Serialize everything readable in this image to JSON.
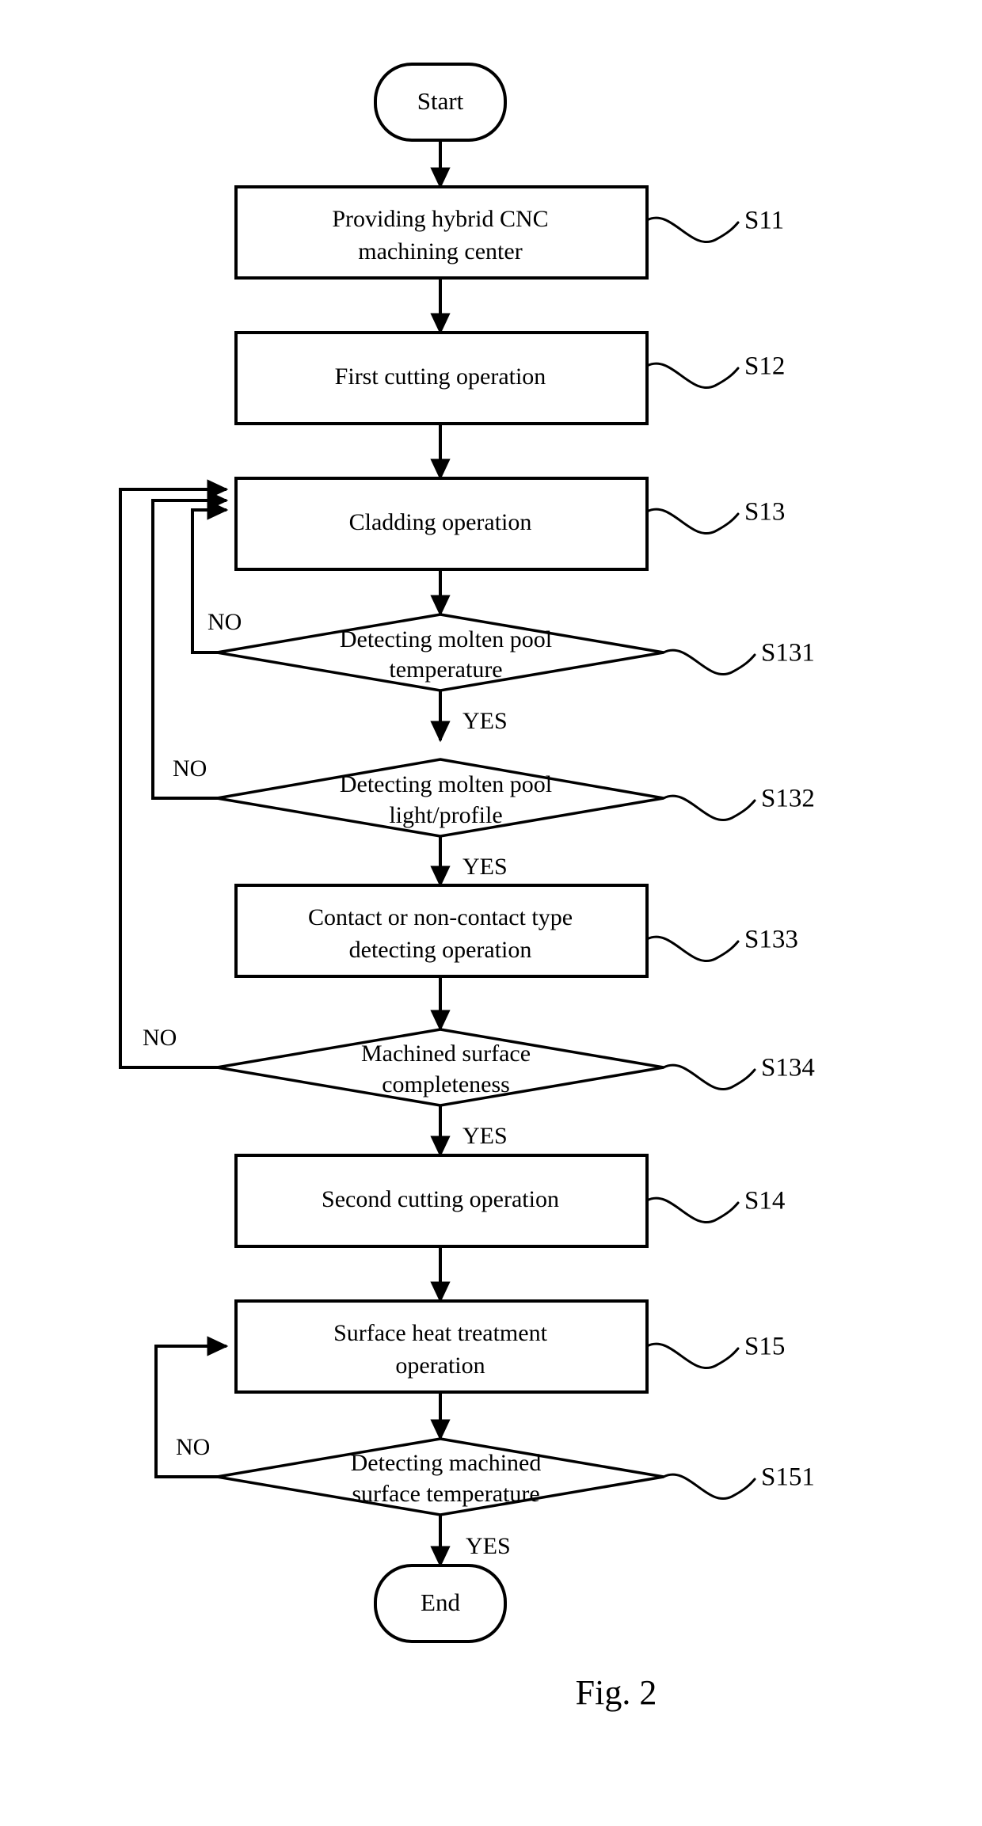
{
  "figure": {
    "caption": "Fig. 2",
    "background_color": "#ffffff",
    "line_color": "#000000"
  },
  "terminals": {
    "start": "Start",
    "end": "End"
  },
  "nodes": [
    {
      "id": "S11",
      "type": "process",
      "line1": "Providing hybrid CNC",
      "line2": "machining center",
      "step": "S11"
    },
    {
      "id": "S12",
      "type": "process",
      "line1": "First cutting operation",
      "line2": "",
      "step": "S12"
    },
    {
      "id": "S13",
      "type": "process",
      "line1": "Cladding operation",
      "line2": "",
      "step": "S13"
    },
    {
      "id": "S131",
      "type": "decision",
      "line1": "Detecting molten pool",
      "line2": "temperature",
      "step": "S131"
    },
    {
      "id": "S132",
      "type": "decision",
      "line1": "Detecting molten pool",
      "line2": "light/profile",
      "step": "S132"
    },
    {
      "id": "S133",
      "type": "process",
      "line1": "Contact or non-contact type",
      "line2": "detecting operation",
      "step": "S133"
    },
    {
      "id": "S134",
      "type": "decision",
      "line1": "Machined surface",
      "line2": "completeness",
      "step": "S134"
    },
    {
      "id": "S14",
      "type": "process",
      "line1": "Second cutting operation",
      "line2": "",
      "step": "S14"
    },
    {
      "id": "S15",
      "type": "process",
      "line1": "Surface heat treatment",
      "line2": "operation",
      "step": "S15"
    },
    {
      "id": "S151",
      "type": "decision",
      "line1": "Detecting machined",
      "line2": "surface temperature",
      "step": "S151"
    }
  ],
  "branch_labels": {
    "no_s131": "NO",
    "yes_s131": "YES",
    "no_s132": "NO",
    "yes_s132": "YES",
    "no_s134": "NO",
    "yes_s134": "YES",
    "no_s151": "NO",
    "yes_s151": "YES"
  },
  "chart_data": {
    "type": "table",
    "title": "Fig. 2",
    "nodes": [
      {
        "id": "start",
        "shape": "terminator",
        "text": "Start"
      },
      {
        "id": "S11",
        "shape": "rectangle",
        "text": "Providing hybrid CNC machining center"
      },
      {
        "id": "S12",
        "shape": "rectangle",
        "text": "First cutting operation"
      },
      {
        "id": "S13",
        "shape": "rectangle",
        "text": "Cladding operation"
      },
      {
        "id": "S131",
        "shape": "diamond",
        "text": "Detecting molten pool temperature"
      },
      {
        "id": "S132",
        "shape": "diamond",
        "text": "Detecting molten pool light/profile"
      },
      {
        "id": "S133",
        "shape": "rectangle",
        "text": "Contact or non-contact type detecting operation"
      },
      {
        "id": "S134",
        "shape": "diamond",
        "text": "Machined surface completeness"
      },
      {
        "id": "S14",
        "shape": "rectangle",
        "text": "Second cutting operation"
      },
      {
        "id": "S15",
        "shape": "rectangle",
        "text": "Surface heat treatment operation"
      },
      {
        "id": "S151",
        "shape": "diamond",
        "text": "Detecting machined surface temperature"
      },
      {
        "id": "end",
        "shape": "terminator",
        "text": "End"
      }
    ],
    "edges": [
      {
        "from": "start",
        "to": "S11",
        "label": ""
      },
      {
        "from": "S11",
        "to": "S12",
        "label": ""
      },
      {
        "from": "S12",
        "to": "S13",
        "label": ""
      },
      {
        "from": "S13",
        "to": "S131",
        "label": ""
      },
      {
        "from": "S131",
        "to": "S13",
        "label": "NO"
      },
      {
        "from": "S131",
        "to": "S132",
        "label": "YES"
      },
      {
        "from": "S132",
        "to": "S13",
        "label": "NO"
      },
      {
        "from": "S132",
        "to": "S133",
        "label": "YES"
      },
      {
        "from": "S133",
        "to": "S134",
        "label": ""
      },
      {
        "from": "S134",
        "to": "S13",
        "label": "NO"
      },
      {
        "from": "S134",
        "to": "S14",
        "label": "YES"
      },
      {
        "from": "S14",
        "to": "S15",
        "label": ""
      },
      {
        "from": "S15",
        "to": "S151",
        "label": ""
      },
      {
        "from": "S151",
        "to": "S15",
        "label": "NO"
      },
      {
        "from": "S151",
        "to": "end",
        "label": "YES"
      }
    ]
  }
}
